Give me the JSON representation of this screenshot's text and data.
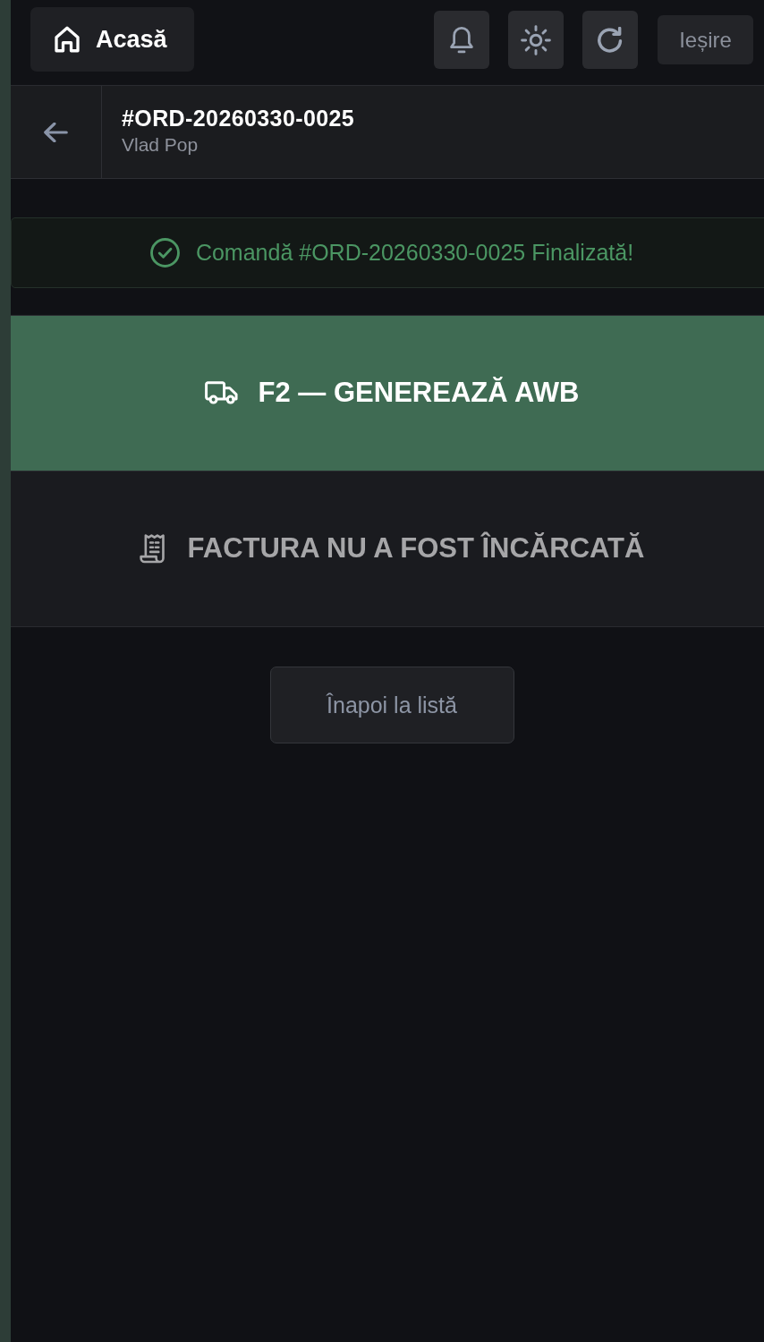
{
  "top_bar": {
    "home_button": {
      "label": "Acasă"
    },
    "exit_button": {
      "label": "Ieșire"
    }
  },
  "order_header": {
    "order_number": "#ORD-20260330-0025",
    "customer": "Vlad Pop"
  },
  "success_banner": {
    "message": "Comandă #ORD-20260330-0025 Finalizată!"
  },
  "actions": [
    {
      "kind": "awb",
      "label": "F2 — GENEREAZĂ AWB",
      "disabled": false
    },
    {
      "kind": "invoice",
      "label": "FACTURA NU A FOST ÎNCĂRCATĂ",
      "disabled": true
    }
  ],
  "back_button": {
    "label": "Înapoi la listă"
  }
}
